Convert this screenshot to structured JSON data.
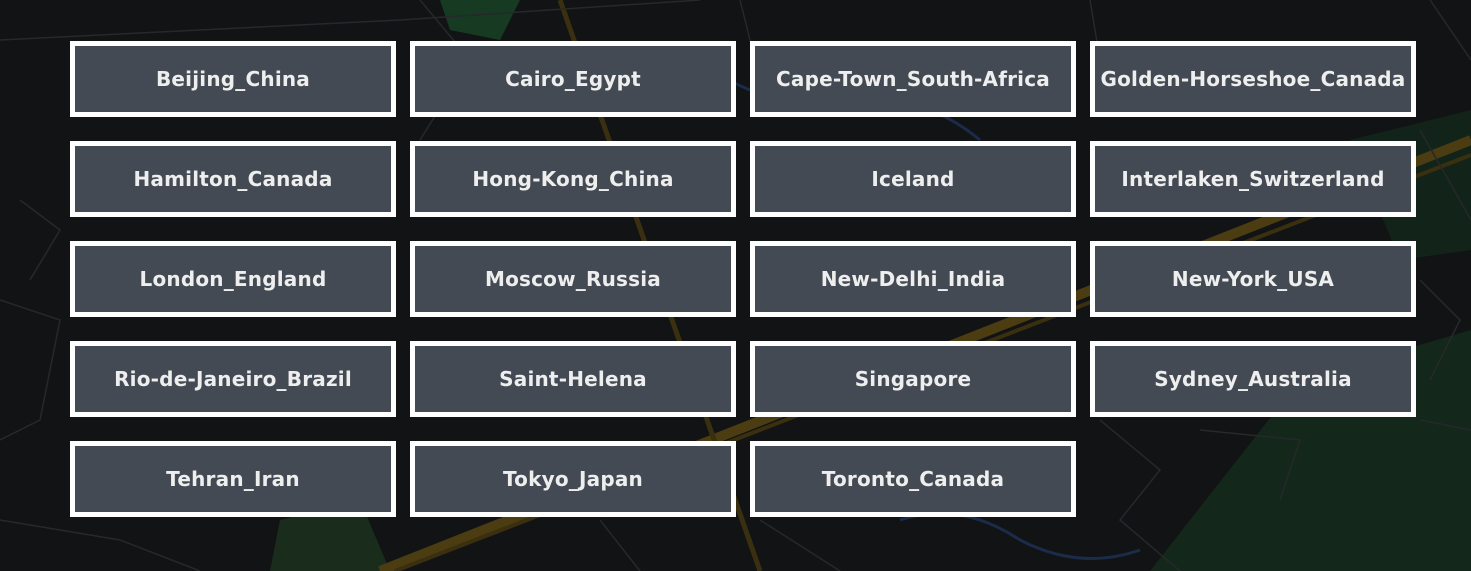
{
  "theme": {
    "button_fill": "#434a53",
    "button_border": "#ffffff",
    "button_text": "#eeeeee",
    "background": "#121314"
  },
  "locations": [
    "Beijing_China",
    "Cairo_Egypt",
    "Cape-Town_South-Africa",
    "Golden-Horseshoe_Canada",
    "Hamilton_Canada",
    "Hong-Kong_China",
    "Iceland",
    "Interlaken_Switzerland",
    "London_England",
    "Moscow_Russia",
    "New-Delhi_India",
    "New-York_USA",
    "Rio-de-Janeiro_Brazil",
    "Saint-Helena",
    "Singapore",
    "Sydney_Australia",
    "Tehran_Iran",
    "Tokyo_Japan",
    "Toronto_Canada"
  ]
}
